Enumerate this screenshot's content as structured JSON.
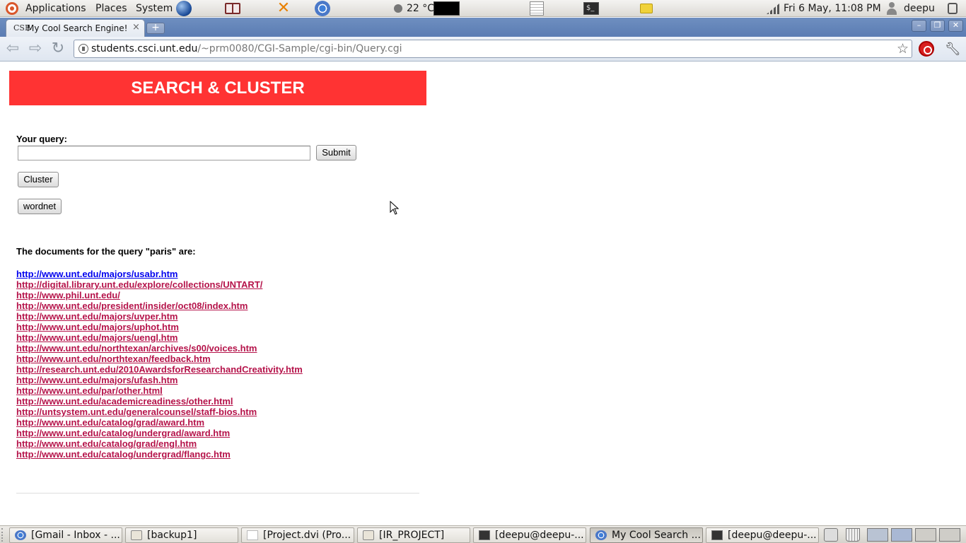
{
  "panel": {
    "menus": [
      "Applications",
      "Places",
      "System"
    ],
    "weather": "22 °C",
    "clock": "Fri  6 May, 11:08 PM",
    "user": "deepu"
  },
  "browser": {
    "tab_title": "My Cool Search Engine!",
    "tab_favicon_text": "CSE",
    "new_tab_label": "+",
    "url_host": "students.csci.unt.edu",
    "url_path": "/~prm0080/CGI-Sample/cgi-bin/Query.cgi"
  },
  "page": {
    "banner": "SEARCH & CLUSTER",
    "query_label": "Your query:",
    "query_value": "",
    "submit_label": "Submit",
    "cluster_label": "Cluster",
    "wordnet_label": "wordnet",
    "results_heading": "The documents for the query \"paris\" are:",
    "results": [
      "http://www.unt.edu/majors/usabr.htm",
      "http://digital.library.unt.edu/explore/collections/UNTART/",
      "http://www.phil.unt.edu/",
      "http://www.unt.edu/president/insider/oct08/index.htm",
      "http://www.unt.edu/majors/uvper.htm",
      "http://www.unt.edu/majors/uphot.htm",
      "http://www.unt.edu/majors/uengl.htm",
      "http://www.unt.edu/northtexan/archives/s00/voices.htm",
      "http://www.unt.edu/northtexan/feedback.htm",
      "http://research.unt.edu/2010AwardsforResearchandCreativity.htm",
      "http://www.unt.edu/majors/ufash.htm",
      "http://www.unt.edu/par/other.html",
      "http://www.unt.edu/academicreadiness/other.html",
      "http://untsystem.unt.edu/generalcounsel/staff-bios.htm",
      "http://www.unt.edu/catalog/grad/award.htm",
      "http://www.unt.edu/catalog/undergrad/award.htm",
      "http://www.unt.edu/catalog/grad/engl.htm",
      "http://www.unt.edu/catalog/undergrad/flangc.htm"
    ],
    "colors": {
      "banner": "#ff3333",
      "link_visited": "#b5134a",
      "link": "#0000ee"
    }
  },
  "taskbar": {
    "items": [
      {
        "label": "[Gmail - Inbox - ...",
        "icon": "chrome-icon"
      },
      {
        "label": "[backup1]",
        "icon": "folder-icon"
      },
      {
        "label": "[Project.dvi (Pro...",
        "icon": "document-icon"
      },
      {
        "label": "[IR_PROJECT]",
        "icon": "folder-icon"
      },
      {
        "label": "[deepu@deepu-...",
        "icon": "terminal-icon"
      },
      {
        "label": "My Cool Search ...",
        "icon": "chrome-icon"
      },
      {
        "label": "[deepu@deepu-...",
        "icon": "terminal-icon"
      }
    ]
  }
}
